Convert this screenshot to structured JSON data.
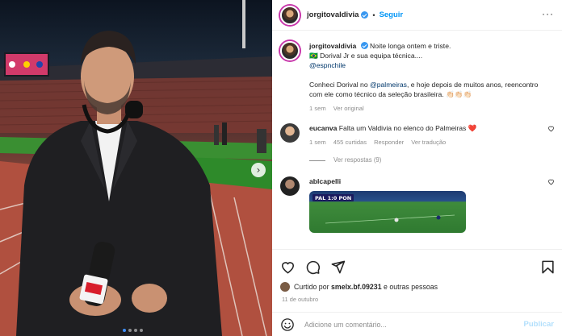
{
  "post": {
    "username": "jorgitovaldivia",
    "follow_label": "Seguir",
    "separator": "•",
    "more_label": "···"
  },
  "caption": {
    "username": "jorgitovaldivia",
    "line1": "Noite longa ontem e triste.",
    "line2": "🇧🇷 Dorival Jr e sua equipa técnica....",
    "mention1": "@espnchile",
    "line3_prefix": "Conheci Dorival no ",
    "mention2": "@palmeiras",
    "line3_suffix": ", e hoje depois de muitos anos, reencontro com ele como técnico da seleção brasileira. 👏🏻👏🏻👏🏻",
    "time": "1 sem",
    "translation_label": "Ver original"
  },
  "comments": [
    {
      "username": "eucanva",
      "text": "Falta um Valdivia no elenco do Palmeiras ❤️",
      "time": "1 sem",
      "likes": "455 curtidas",
      "reply_label": "Responder",
      "translation_label": "Ver tradução",
      "view_replies": "Ver respostas (9)"
    },
    {
      "username": "ablcapelli",
      "video_score": "PAL 1:0 PON"
    }
  ],
  "actions": {
    "liked_by_prefix": "Curtido por ",
    "liked_by_user": "smelx.bf.09231",
    "liked_by_suffix": " e outras pessoas",
    "date": "11 de outubro"
  },
  "add_comment": {
    "placeholder": "Adicione um comentário...",
    "publish_label": "Publicar"
  },
  "colors": {
    "link": "#00376b",
    "accent": "#0095f6",
    "verified": "#3897f0",
    "publish_disabled": "#b2dffc"
  },
  "carousel": {
    "slides": 4,
    "active": 1
  }
}
